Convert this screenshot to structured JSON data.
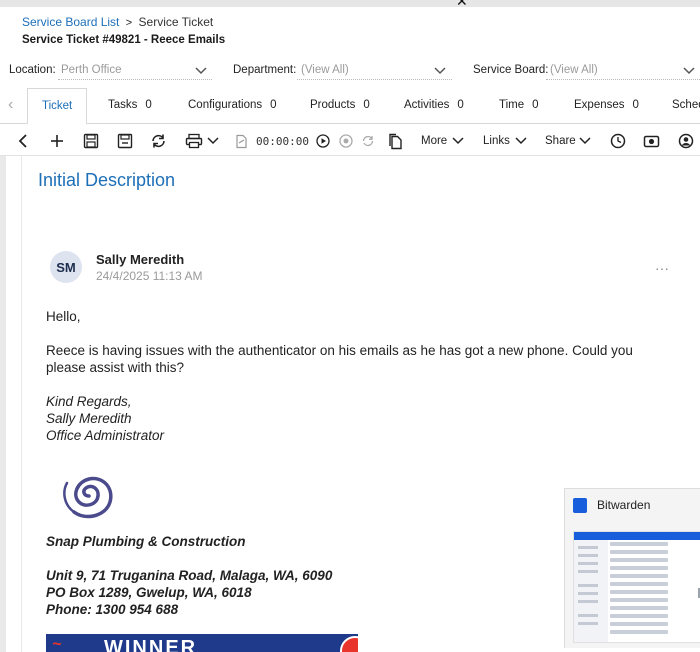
{
  "breadcrumb": {
    "parent": "Service Board List",
    "separator": ">",
    "current": "Service Ticket"
  },
  "ticket_title": "Service Ticket #49821 - Reece Emails",
  "filters": {
    "location_label": "Location:",
    "location_value": "Perth Office",
    "department_label": "Department:",
    "department_value": "(View All)",
    "board_label": "Service Board:",
    "board_value": "(View All)"
  },
  "tabs": [
    {
      "label": "Ticket",
      "count": ""
    },
    {
      "label": "Tasks",
      "count": "0"
    },
    {
      "label": "Configurations",
      "count": "0"
    },
    {
      "label": "Products",
      "count": "0"
    },
    {
      "label": "Activities",
      "count": "0"
    },
    {
      "label": "Time",
      "count": "0"
    },
    {
      "label": "Expenses",
      "count": "0"
    },
    {
      "label": "Sched",
      "count": ""
    }
  ],
  "toolbar": {
    "timer": "00:00:00",
    "more_label": "More",
    "links_label": "Links",
    "share_label": "Share"
  },
  "section_title": "Initial Description",
  "note": {
    "avatar_initials": "SM",
    "author": "Sally Meredith",
    "timestamp": "24/4/2025 11:13 AM",
    "more": "···"
  },
  "message": {
    "greeting": "Hello,",
    "body_line1": "Reece is having issues with the authenticator on his emails as he has got a new phone. Could you",
    "body_line2": "please assist with this?",
    "signoff1": "Kind Regards,",
    "signoff2": "Sally Meredith",
    "signoff3": "Office Administrator",
    "company": "Snap Plumbing & Construction",
    "address1": "Unit 9, 71 Truganina Road, Malaga, WA, 6090",
    "address2": "PO Box 1289, Gwelup, WA, 6018",
    "phone": "Phone: 1300 954 688",
    "banner_text": "WINNER"
  },
  "bitwarden": {
    "title": "Bitwarden"
  },
  "colors": {
    "link": "#1d6fb8",
    "muted": "#9a9a9a",
    "bitwarden_blue": "#175ddc"
  }
}
